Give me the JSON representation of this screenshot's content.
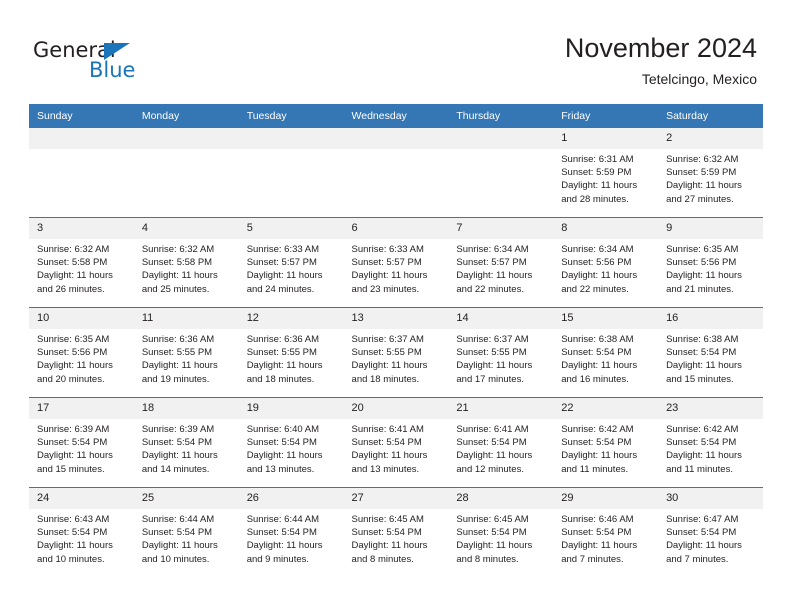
{
  "brand": {
    "logo_text_primary": "General",
    "logo_text_secondary": "Blue",
    "logo_icon": "triangle-icon",
    "accent_color": "#1b75bb"
  },
  "header": {
    "title": "November 2024",
    "subtitle": "Tetelcingo, Mexico"
  },
  "colors": {
    "header_blue": "#3577b5",
    "daynum_band": "#f1f1f1",
    "text": "#231f20"
  },
  "calendar": {
    "weekday_headers": [
      "Sunday",
      "Monday",
      "Tuesday",
      "Wednesday",
      "Thursday",
      "Friday",
      "Saturday"
    ],
    "labels": {
      "sunrise": "Sunrise:",
      "sunset": "Sunset:",
      "daylight": "Daylight:"
    },
    "weeks": [
      [
        {
          "day": "",
          "empty": true
        },
        {
          "day": "",
          "empty": true
        },
        {
          "day": "",
          "empty": true
        },
        {
          "day": "",
          "empty": true
        },
        {
          "day": "",
          "empty": true
        },
        {
          "day": "1",
          "sunrise": "Sunrise: 6:31 AM",
          "sunset": "Sunset: 5:59 PM",
          "daylight": "Daylight: 11 hours and 28 minutes."
        },
        {
          "day": "2",
          "sunrise": "Sunrise: 6:32 AM",
          "sunset": "Sunset: 5:59 PM",
          "daylight": "Daylight: 11 hours and 27 minutes."
        }
      ],
      [
        {
          "day": "3",
          "sunrise": "Sunrise: 6:32 AM",
          "sunset": "Sunset: 5:58 PM",
          "daylight": "Daylight: 11 hours and 26 minutes."
        },
        {
          "day": "4",
          "sunrise": "Sunrise: 6:32 AM",
          "sunset": "Sunset: 5:58 PM",
          "daylight": "Daylight: 11 hours and 25 minutes."
        },
        {
          "day": "5",
          "sunrise": "Sunrise: 6:33 AM",
          "sunset": "Sunset: 5:57 PM",
          "daylight": "Daylight: 11 hours and 24 minutes."
        },
        {
          "day": "6",
          "sunrise": "Sunrise: 6:33 AM",
          "sunset": "Sunset: 5:57 PM",
          "daylight": "Daylight: 11 hours and 23 minutes."
        },
        {
          "day": "7",
          "sunrise": "Sunrise: 6:34 AM",
          "sunset": "Sunset: 5:57 PM",
          "daylight": "Daylight: 11 hours and 22 minutes."
        },
        {
          "day": "8",
          "sunrise": "Sunrise: 6:34 AM",
          "sunset": "Sunset: 5:56 PM",
          "daylight": "Daylight: 11 hours and 22 minutes."
        },
        {
          "day": "9",
          "sunrise": "Sunrise: 6:35 AM",
          "sunset": "Sunset: 5:56 PM",
          "daylight": "Daylight: 11 hours and 21 minutes."
        }
      ],
      [
        {
          "day": "10",
          "sunrise": "Sunrise: 6:35 AM",
          "sunset": "Sunset: 5:56 PM",
          "daylight": "Daylight: 11 hours and 20 minutes."
        },
        {
          "day": "11",
          "sunrise": "Sunrise: 6:36 AM",
          "sunset": "Sunset: 5:55 PM",
          "daylight": "Daylight: 11 hours and 19 minutes."
        },
        {
          "day": "12",
          "sunrise": "Sunrise: 6:36 AM",
          "sunset": "Sunset: 5:55 PM",
          "daylight": "Daylight: 11 hours and 18 minutes."
        },
        {
          "day": "13",
          "sunrise": "Sunrise: 6:37 AM",
          "sunset": "Sunset: 5:55 PM",
          "daylight": "Daylight: 11 hours and 18 minutes."
        },
        {
          "day": "14",
          "sunrise": "Sunrise: 6:37 AM",
          "sunset": "Sunset: 5:55 PM",
          "daylight": "Daylight: 11 hours and 17 minutes."
        },
        {
          "day": "15",
          "sunrise": "Sunrise: 6:38 AM",
          "sunset": "Sunset: 5:54 PM",
          "daylight": "Daylight: 11 hours and 16 minutes."
        },
        {
          "day": "16",
          "sunrise": "Sunrise: 6:38 AM",
          "sunset": "Sunset: 5:54 PM",
          "daylight": "Daylight: 11 hours and 15 minutes."
        }
      ],
      [
        {
          "day": "17",
          "sunrise": "Sunrise: 6:39 AM",
          "sunset": "Sunset: 5:54 PM",
          "daylight": "Daylight: 11 hours and 15 minutes."
        },
        {
          "day": "18",
          "sunrise": "Sunrise: 6:39 AM",
          "sunset": "Sunset: 5:54 PM",
          "daylight": "Daylight: 11 hours and 14 minutes."
        },
        {
          "day": "19",
          "sunrise": "Sunrise: 6:40 AM",
          "sunset": "Sunset: 5:54 PM",
          "daylight": "Daylight: 11 hours and 13 minutes."
        },
        {
          "day": "20",
          "sunrise": "Sunrise: 6:41 AM",
          "sunset": "Sunset: 5:54 PM",
          "daylight": "Daylight: 11 hours and 13 minutes."
        },
        {
          "day": "21",
          "sunrise": "Sunrise: 6:41 AM",
          "sunset": "Sunset: 5:54 PM",
          "daylight": "Daylight: 11 hours and 12 minutes."
        },
        {
          "day": "22",
          "sunrise": "Sunrise: 6:42 AM",
          "sunset": "Sunset: 5:54 PM",
          "daylight": "Daylight: 11 hours and 11 minutes."
        },
        {
          "day": "23",
          "sunrise": "Sunrise: 6:42 AM",
          "sunset": "Sunset: 5:54 PM",
          "daylight": "Daylight: 11 hours and 11 minutes."
        }
      ],
      [
        {
          "day": "24",
          "sunrise": "Sunrise: 6:43 AM",
          "sunset": "Sunset: 5:54 PM",
          "daylight": "Daylight: 11 hours and 10 minutes."
        },
        {
          "day": "25",
          "sunrise": "Sunrise: 6:44 AM",
          "sunset": "Sunset: 5:54 PM",
          "daylight": "Daylight: 11 hours and 10 minutes."
        },
        {
          "day": "26",
          "sunrise": "Sunrise: 6:44 AM",
          "sunset": "Sunset: 5:54 PM",
          "daylight": "Daylight: 11 hours and 9 minutes."
        },
        {
          "day": "27",
          "sunrise": "Sunrise: 6:45 AM",
          "sunset": "Sunset: 5:54 PM",
          "daylight": "Daylight: 11 hours and 8 minutes."
        },
        {
          "day": "28",
          "sunrise": "Sunrise: 6:45 AM",
          "sunset": "Sunset: 5:54 PM",
          "daylight": "Daylight: 11 hours and 8 minutes."
        },
        {
          "day": "29",
          "sunrise": "Sunrise: 6:46 AM",
          "sunset": "Sunset: 5:54 PM",
          "daylight": "Daylight: 11 hours and 7 minutes."
        },
        {
          "day": "30",
          "sunrise": "Sunrise: 6:47 AM",
          "sunset": "Sunset: 5:54 PM",
          "daylight": "Daylight: 11 hours and 7 minutes."
        }
      ]
    ]
  }
}
